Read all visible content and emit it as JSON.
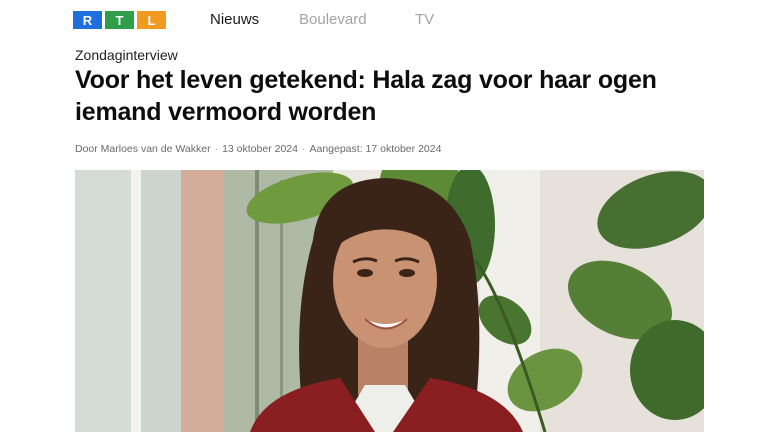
{
  "brand": {
    "letters": [
      "R",
      "T",
      "L"
    ],
    "colors": [
      "#1f6fdc",
      "#2f9e4a",
      "#f29a1f"
    ]
  },
  "nav": {
    "items": [
      "Nieuws",
      "Boulevard",
      "TV"
    ],
    "active": "Nieuws"
  },
  "article": {
    "kicker": "Zondaginterview",
    "title": "Voor het leven getekend: Hala zag voor haar ogen iemand vermoord worden",
    "author": "Door Marloes van de Wakker",
    "separator": "·",
    "published": "13 oktober 2024",
    "updated": "Aangepast: 17 oktober 2024"
  },
  "photo": {
    "subject": "portrait-photo",
    "colors": {
      "wall": "#ece9e3",
      "window": "#cfd6cf",
      "frame": "#c99a86",
      "leaf": "#4f7d3a",
      "hair": "#3a2418",
      "skin": "#c99273",
      "jacket": "#8a1f22",
      "shirt": "#eeeeea"
    }
  }
}
